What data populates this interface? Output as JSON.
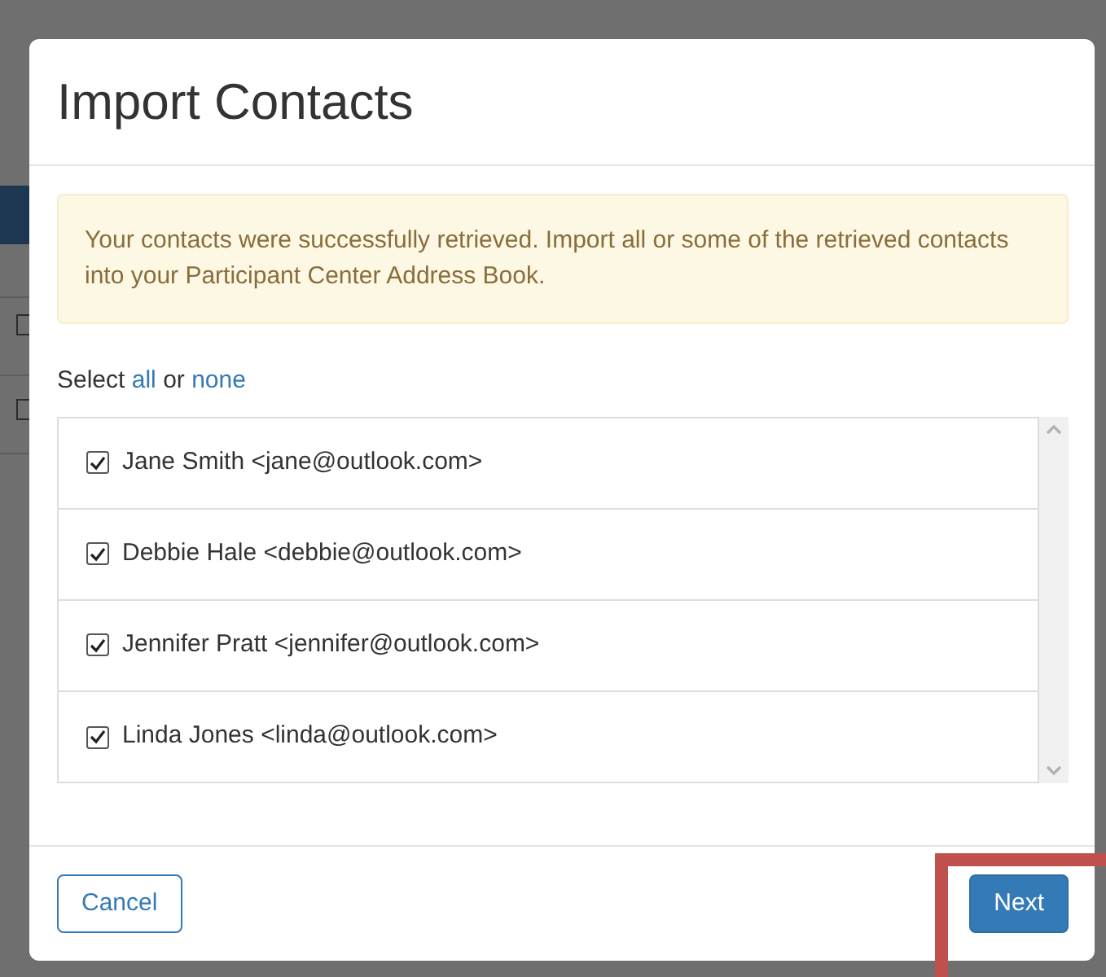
{
  "background": {
    "checkboxes": [
      {
        "checked": false
      },
      {
        "checked": false
      }
    ]
  },
  "dialog": {
    "title": "Import Contacts",
    "alert": "Your contacts were successfully retrieved. Import all or some of the retrieved contacts into your Participant Center Address Book.",
    "select": {
      "prefix": "Select",
      "all": "all",
      "joiner": "or",
      "none": "none"
    },
    "contacts": [
      {
        "label": "Jane Smith <jane@outlook.com>",
        "checked": true
      },
      {
        "label": "Debbie Hale <debbie@outlook.com>",
        "checked": true
      },
      {
        "label": "Jennifer Pratt <jennifer@outlook.com>",
        "checked": true
      },
      {
        "label": "Linda Jones <linda@outlook.com>",
        "checked": true
      }
    ],
    "buttons": [
      {
        "label": "Cancel",
        "kind": "secondary"
      },
      {
        "label": "Next",
        "kind": "primary",
        "highlighted": true
      }
    ]
  }
}
